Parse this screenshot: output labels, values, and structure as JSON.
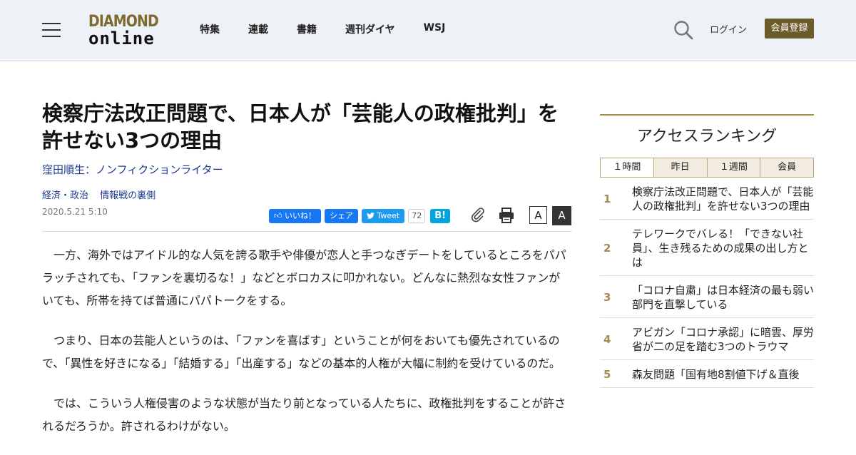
{
  "header": {
    "logo": {
      "line1": "DIAMOND",
      "line2": "online"
    },
    "nav": [
      "特集",
      "連載",
      "書籍",
      "週刊ダイヤ",
      "WSJ"
    ],
    "login_label": "ログイン",
    "register_label": "会員登録"
  },
  "article": {
    "title": "検察庁法改正問題で、日本人が「芸能人の政権批判」を許せない3つの理由",
    "author": "窪田順生：ノンフィクションライター",
    "categories": [
      "経済・政治",
      "情報戦の裏側"
    ],
    "date": "2020.5.21 5:10",
    "share": {
      "facebook_like": "いいね！",
      "facebook_share": "シェア",
      "tweet": "Tweet",
      "tweet_count": "72",
      "hatena": "B!"
    },
    "font_small": "A",
    "font_large": "A",
    "paragraphs": [
      "一方、海外ではアイドル的な人気を誇る歌手や俳優が恋人と手つなぎデートをしているところをパパラッチされても、「ファンを裏切るな！」などとボロカスに叩かれない。どんなに熱烈な女性ファンがいても、所帯を持てば普通にパパトークをする。",
      "つまり、日本の芸能人というのは、「ファンを喜ばす」ということが何をおいても優先されているので、「異性を好きになる」「結婚する」「出産する」などの基本的人権が大幅に制約を受けているのだ。",
      "では、こういう人権侵害のような状態が当たり前となっている人たちに、政権批判をすることが許されるだろうか。許されるわけがない。"
    ]
  },
  "sidebar": {
    "title": "アクセスランキング",
    "tabs": [
      "１時間",
      "昨日",
      "１週間",
      "会員"
    ],
    "active_tab": 0,
    "ranking": [
      {
        "rank": "1",
        "text": "検察庁法改正問題で、日本人が「芸能人の政権批判」を許せない3つの理由"
      },
      {
        "rank": "2",
        "text": "テレワークでバレる！「できない社員」、生き残るための成果の出し方とは"
      },
      {
        "rank": "3",
        "text": "「コロナ自粛」は日本経済の最も弱い部門を直撃している"
      },
      {
        "rank": "4",
        "text": "アビガン「コロナ承認」に暗雲、厚労省が二の足を踏む3つのトラウマ"
      },
      {
        "rank": "5",
        "text": "森友問題「国有地8割値下げ＆直後"
      }
    ]
  },
  "colors": {
    "header_bg": "#eef1f5",
    "accent_gold": "#a48b4b",
    "register_bg": "#6b5a2a",
    "link_blue": "#1a3a8f"
  },
  "icons": {
    "menu": "hamburger-icon",
    "search": "search-icon",
    "clip": "paperclip-icon",
    "print": "printer-icon"
  }
}
